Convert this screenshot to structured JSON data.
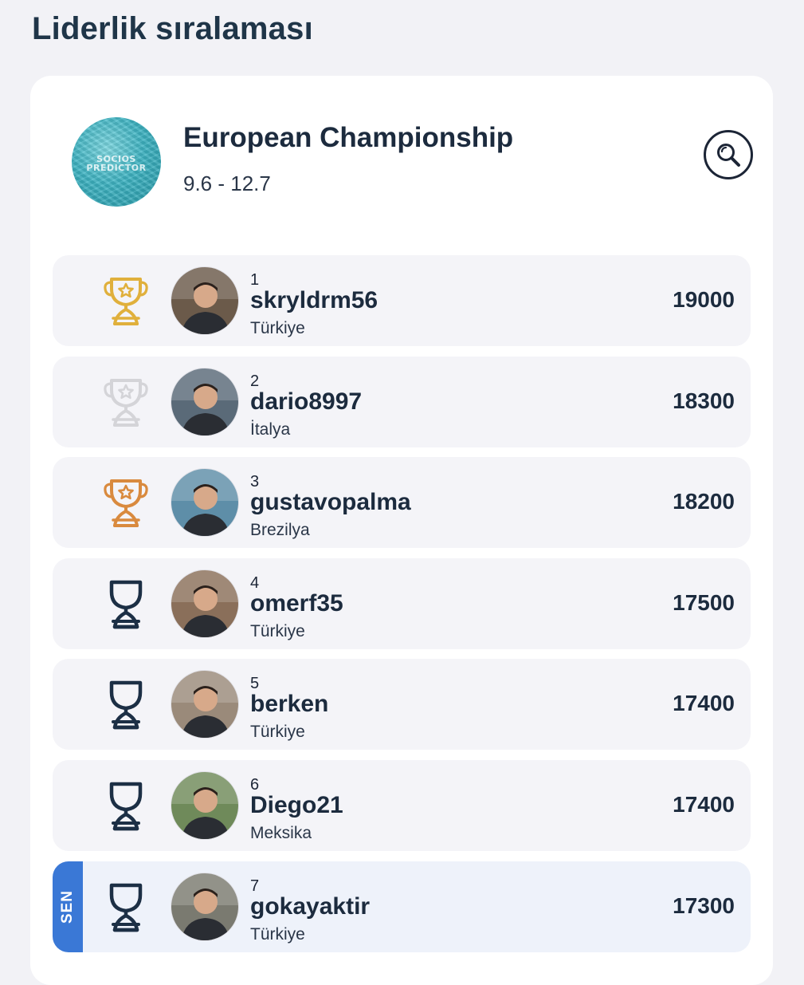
{
  "page": {
    "title": "Liderlik sıralaması"
  },
  "league": {
    "name": "European Championship",
    "dates": "9.6 - 12.7",
    "logo_text_line1": "SOCIOS",
    "logo_text_line2": "PREDICTOR",
    "logo_icon": "league-logo"
  },
  "search": {
    "icon": "search-icon"
  },
  "colors": {
    "gold": "#e0b03c",
    "silver": "#d4d4d8",
    "bronze": "#d98a3e",
    "plain_trophy": "#1c2f45",
    "accent_blue": "#3a78d6"
  },
  "leaderboard": [
    {
      "rank": "1",
      "username": "skryldrm56",
      "country": "Türkiye",
      "score": "19000",
      "trophy": "gold",
      "me": false,
      "avatar": "#6b5a4a"
    },
    {
      "rank": "2",
      "username": "dario8997",
      "country": "İtalya",
      "score": "18300",
      "trophy": "silver",
      "me": false,
      "avatar": "#5a6a78"
    },
    {
      "rank": "3",
      "username": "gustavopalma",
      "country": "Brezilya",
      "score": "18200",
      "trophy": "bronze",
      "me": false,
      "avatar": "#5e8ea8"
    },
    {
      "rank": "4",
      "username": "omerf35",
      "country": "Türkiye",
      "score": "17500",
      "trophy": "plain",
      "me": false,
      "avatar": "#8a6f5a"
    },
    {
      "rank": "5",
      "username": "berken",
      "country": "Türkiye",
      "score": "17400",
      "trophy": "plain",
      "me": false,
      "avatar": "#9a8a7a"
    },
    {
      "rank": "6",
      "username": "Diego21",
      "country": "Meksika",
      "score": "17400",
      "trophy": "plain",
      "me": false,
      "avatar": "#6f8a5a"
    },
    {
      "rank": "7",
      "username": "gokayaktir",
      "country": "Türkiye",
      "score": "17300",
      "trophy": "plain",
      "me": true,
      "me_label": "SEN",
      "avatar": "#7a7a70"
    }
  ]
}
